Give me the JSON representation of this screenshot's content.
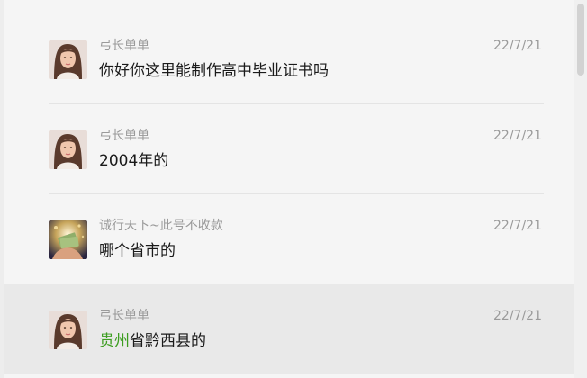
{
  "messages": [
    {
      "sender": "弓长单单",
      "time": "22/7/21",
      "text": "你好你这里能制作高中毕业证书吗",
      "avatar": "woman-portrait-avatar"
    },
    {
      "sender": "弓长单单",
      "time": "22/7/21",
      "text": "2004年的",
      "avatar": "woman-portrait-avatar"
    },
    {
      "sender": "诚行天下~此号不收款",
      "time": "22/7/21",
      "text": "哪个省市的",
      "avatar": "money-hand-avatar"
    },
    {
      "sender": "弓长单单",
      "time": "22/7/21",
      "text_link": "贵州",
      "text_rest": "省黔西县的",
      "avatar": "woman-portrait-avatar",
      "highlighted": true
    }
  ],
  "colors": {
    "link": "#3c9d20",
    "meta_text": "#9a9a9a",
    "highlight_row": "#e9e9e9"
  }
}
